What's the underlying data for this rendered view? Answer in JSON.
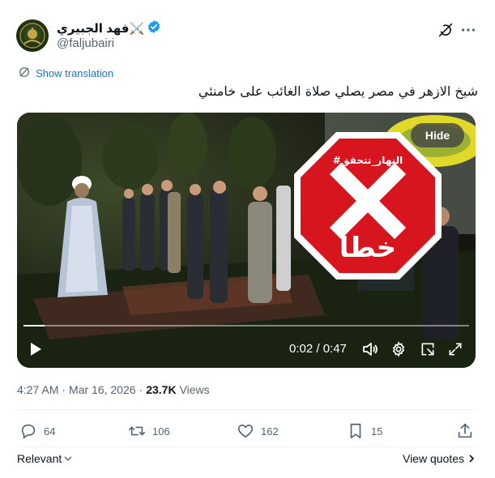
{
  "author": {
    "display_name": "⚔️فهد الجبيري",
    "handle": "@faljubairi",
    "verified": true
  },
  "translate_label": "Show translation",
  "tweet_text": "شيخ الازهر في مصر يصلي صلاة الغائب على خامنئي",
  "video": {
    "hide_label": "Hide",
    "time": "0:02 / 0:47",
    "progress": 0.047,
    "overlay": {
      "hashtag": "#النهار_تتحقق",
      "verdict": "خطأ",
      "color": "#d7151f"
    }
  },
  "meta": {
    "time": "4:27 AM",
    "separator": "·",
    "date": "Mar 16, 2026",
    "views_count": "23.7K",
    "views_label": "Views"
  },
  "actions": {
    "replies": "64",
    "reposts": "106",
    "likes": "162",
    "bookmarks": "15"
  },
  "footer": {
    "sort_label": "Relevant",
    "quotes_label": "View quotes"
  },
  "colors": {
    "link_blue": "#1d9bf0",
    "muted": "#536471",
    "text": "#0f1419"
  },
  "icons": [
    "avatar-emblem",
    "verified-badge-icon",
    "grok-icon",
    "more-icon",
    "translate-icon",
    "play-icon",
    "volume-icon",
    "settings-icon",
    "pip-icon",
    "fullscreen-icon",
    "reply-icon",
    "repost-icon",
    "like-icon",
    "bookmark-icon",
    "share-icon",
    "chevron-down-icon",
    "chevron-right-icon"
  ]
}
